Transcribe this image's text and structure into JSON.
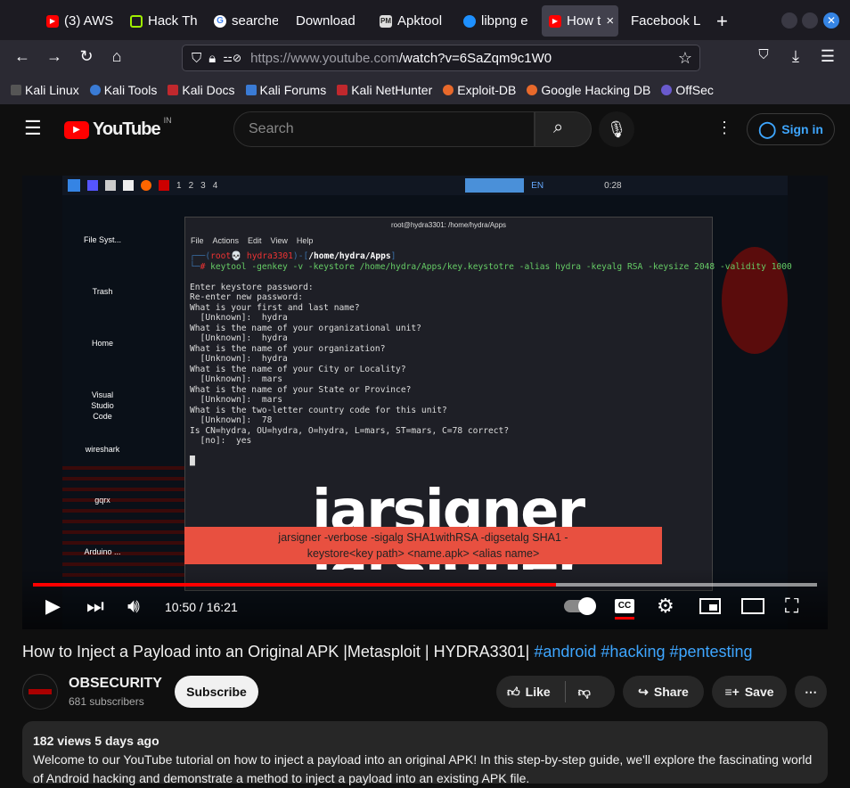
{
  "browser": {
    "tabs": [
      {
        "label": "(3) AWS",
        "icon": "youtube-icon",
        "color": "#ff0000"
      },
      {
        "label": "Hack Th",
        "icon": "hackthebox-icon",
        "color": "#9fef00"
      },
      {
        "label": "searche",
        "icon": "google-icon",
        "color": "#ffffff"
      },
      {
        "label": "Download",
        "icon": "none",
        "color": ""
      },
      {
        "label": "Apktool",
        "icon": "pm-icon",
        "color": "#cccccc"
      },
      {
        "label": "libpng e",
        "icon": "libpng-icon",
        "color": "#1e90ff"
      },
      {
        "label": "How t",
        "icon": "youtube-icon",
        "color": "#ff0000",
        "active": true
      },
      {
        "label": "Facebook L",
        "icon": "none",
        "color": ""
      }
    ],
    "new_tab": "+",
    "url_host": "https://www.youtube.com",
    "url_path": "/watch?v=6SaZqm9c1W0",
    "bookmarks": [
      "Kali Linux",
      "Kali Tools",
      "Kali Docs",
      "Kali Forums",
      "Kali NetHunter",
      "Exploit-DB",
      "Google Hacking DB",
      "OffSec"
    ]
  },
  "youtube": {
    "logo": "YouTube",
    "region": "IN",
    "search_placeholder": "Search",
    "sign_in": "Sign in"
  },
  "video": {
    "terminal_title": "root@hydra3301: /home/hydra/Apps",
    "terminal_menu": [
      "File",
      "Actions",
      "Edit",
      "View",
      "Help"
    ],
    "prompt_user": "root💀 hydra3301",
    "prompt_path": "/home/hydra/Apps",
    "command": "keytool -genkey -v -keystore /home/hydra/Apps/key.keystotre -alias hydra -keyalg RSA -keysize 2048 -validity 1000",
    "output": "Enter keystore password:\nRe-enter new password:\nWhat is your first and last name?\n  [Unknown]:  hydra\nWhat is the name of your organizational unit?\n  [Unknown]:  hydra\nWhat is the name of your organization?\n  [Unknown]:  hydra\nWhat is the name of your City or Locality?\n  [Unknown]:  mars\nWhat is the name of your State or Province?\n  [Unknown]:  mars\nWhat is the two-letter country code for this unit?\n  [Unknown]:  78\nIs CN=hydra, OU=hydra, O=hydra, L=mars, ST=mars, C=78 correct?\n  [no]:  yes",
    "desktop_icons": [
      "File Syst...",
      "Trash",
      "Home",
      "Visual Studio Code",
      "wireshark",
      "gqrx",
      "Arduino ..."
    ],
    "workspaces": [
      "1",
      "2",
      "3",
      "4"
    ],
    "tray_lang": "EN",
    "tray_time": "0:28",
    "big_text": "jarsigner",
    "overlay_line1": "jarsigner -verbose -sigalg SHA1withRSA -digsetalg SHA1 -",
    "overlay_line2": "keystore<key path> <name.apk> <alias name>",
    "time": "10:50 / 16:21",
    "progress": 0.667,
    "buffered": 1.0
  },
  "meta": {
    "title": "How to Inject a Payload into an Original APK |Metasploit | HYDRA3301| ",
    "hashtags": [
      "#android",
      "#hacking",
      "#pentesting"
    ],
    "channel": "OBSECURITY",
    "subscribers": "681 subscribers",
    "subscribe": "Subscribe",
    "like": "Like",
    "share": "Share",
    "save": "Save",
    "views": "182 views  5 days ago",
    "description": "Welcome to our YouTube tutorial on how to inject a payload into an original APK! In this step-by-step guide, we'll explore the fascinating world of Android hacking and demonstrate a method to inject a payload into an existing APK file."
  }
}
